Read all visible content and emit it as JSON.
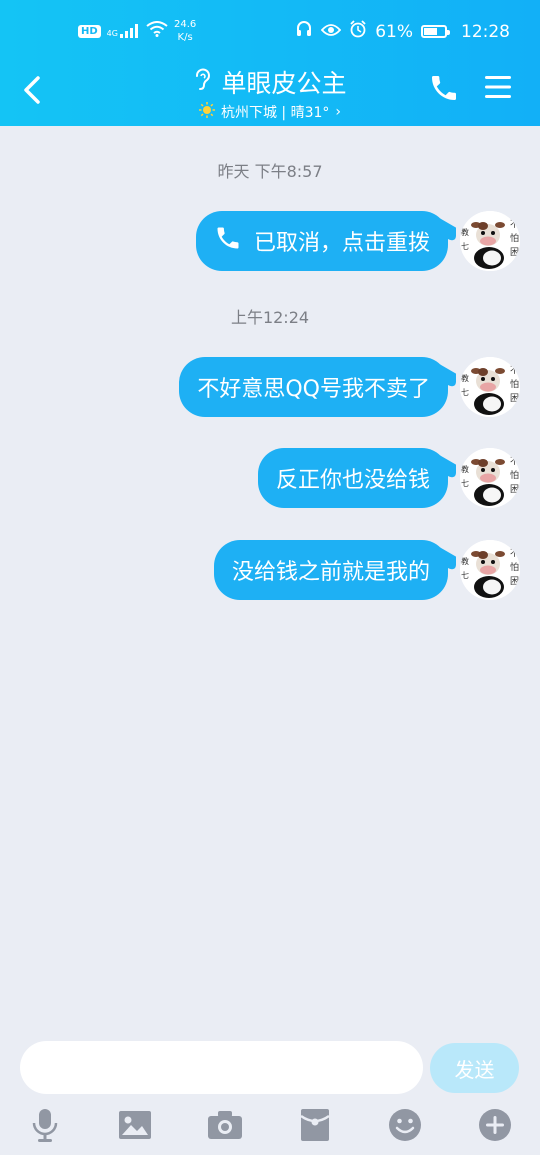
{
  "status_bar": {
    "hd": "HD",
    "network_type": "4G",
    "speed_value": "24.6",
    "speed_unit": "K/s",
    "battery": "61%",
    "time": "12:28"
  },
  "header": {
    "title": "单眼皮公主",
    "weather": "杭州下城 | 晴31°",
    "chevron": "›"
  },
  "messages": [
    {
      "kind": "timestamp",
      "text": "昨天 下午8:57"
    },
    {
      "kind": "call",
      "text": "已取消，点击重拨"
    },
    {
      "kind": "timestamp",
      "text": "上午12:24"
    },
    {
      "kind": "text",
      "text": "不好意思QQ号我不卖了"
    },
    {
      "kind": "text",
      "text": "反正你也没给钱"
    },
    {
      "kind": "text",
      "text": "没给钱之前就是我的"
    }
  ],
  "input": {
    "placeholder": "",
    "send_label": "发送"
  },
  "toolbar": [
    "mic-icon",
    "image-icon",
    "camera-icon",
    "red-packet-icon",
    "emoji-icon",
    "plus-icon"
  ],
  "colors": {
    "header_from": "#14c4f5",
    "header_to": "#12b0f7",
    "bubble": "#1eb0f4",
    "background": "#eaedf4",
    "send_disabled": "#b9e8fa",
    "toolbar_icon": "#9197a3"
  }
}
